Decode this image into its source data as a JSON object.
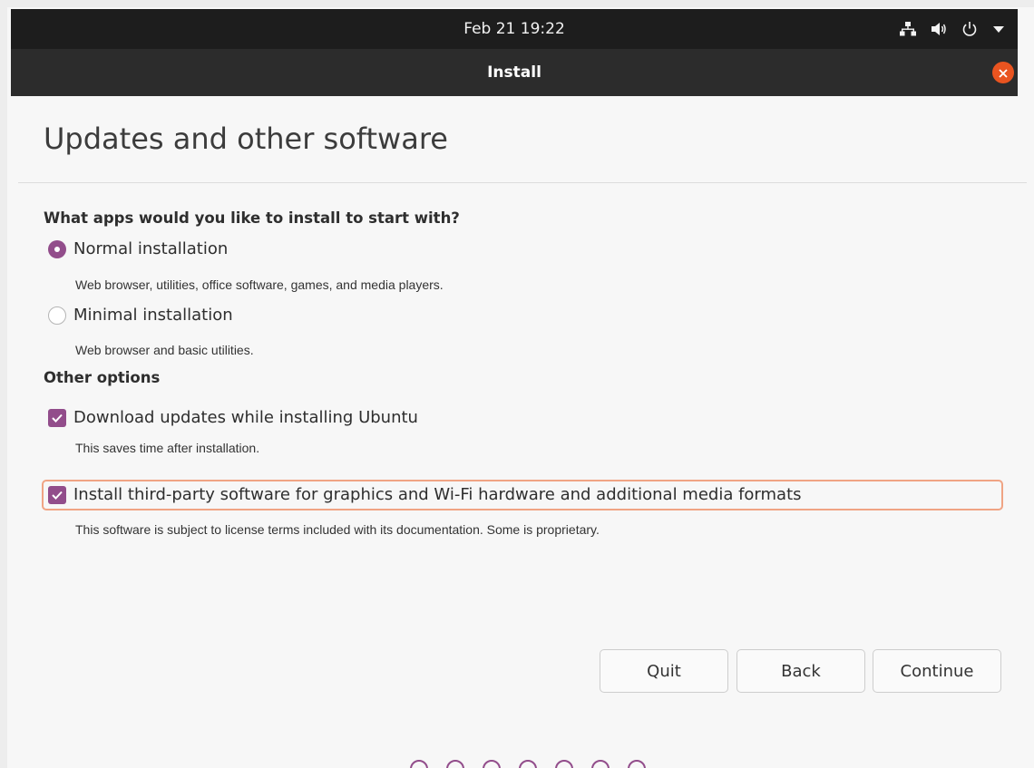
{
  "top_bar": {
    "datetime": "Feb 21  19:22"
  },
  "window": {
    "title": "Install"
  },
  "page": {
    "heading": "Updates and other software"
  },
  "apps_section": {
    "label": "What apps would you like to install to start with?",
    "normal": {
      "label": "Normal installation",
      "description": "Web browser, utilities, office software, games, and media players.",
      "selected": true
    },
    "minimal": {
      "label": "Minimal installation",
      "description": "Web browser and basic utilities.",
      "selected": false
    }
  },
  "other_section": {
    "label": "Other options",
    "download_updates": {
      "label": "Download updates while installing Ubuntu",
      "description": "This saves time after installation.",
      "checked": true
    },
    "third_party": {
      "label": "Install third-party software for graphics and Wi-Fi hardware and additional media formats",
      "description": "This software is subject to license terms included with its documentation. Some is proprietary.",
      "checked": true
    }
  },
  "buttons": {
    "quit": "Quit",
    "back": "Back",
    "continue": "Continue"
  },
  "colors": {
    "accent": "#924d8b",
    "close": "#e95420",
    "focus": "#f0a484"
  }
}
